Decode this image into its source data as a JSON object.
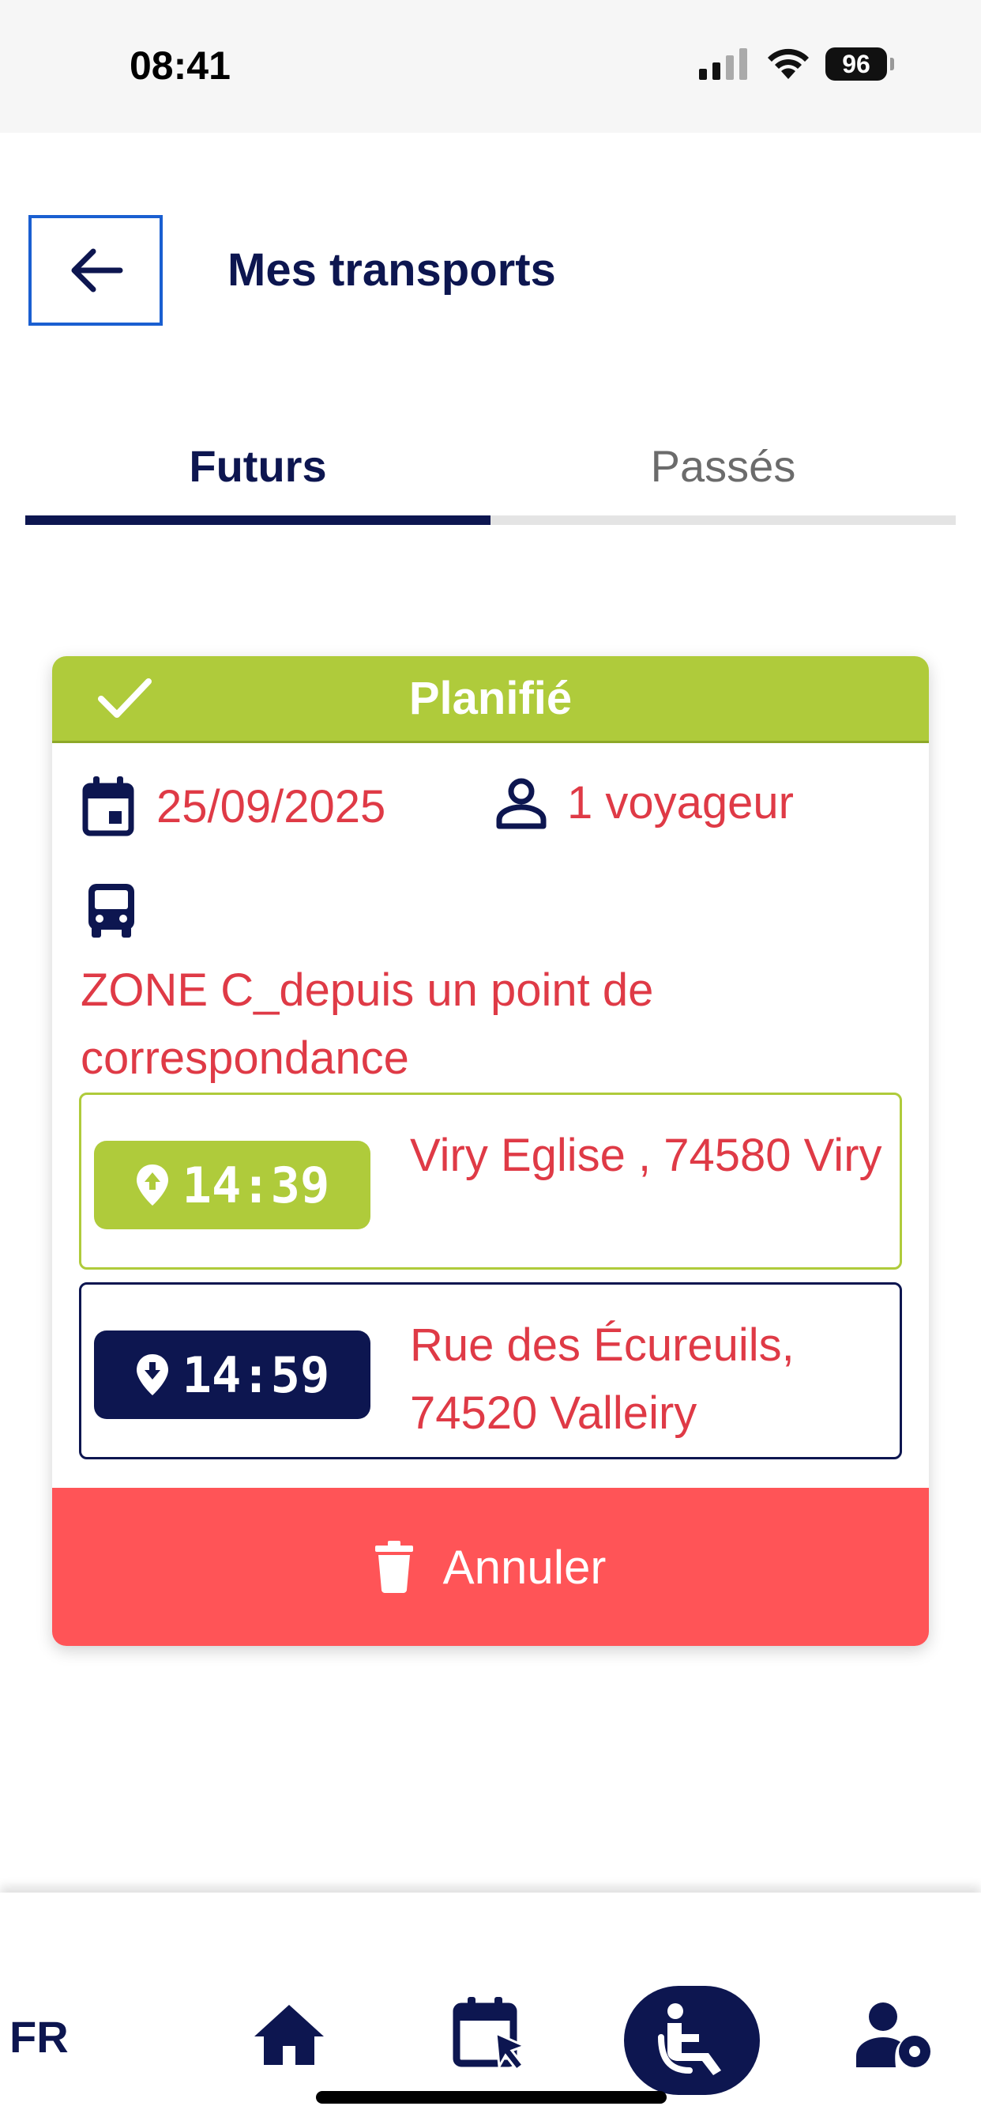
{
  "status_bar": {
    "time": "08:41",
    "battery": "96"
  },
  "header": {
    "title": "Mes transports",
    "back_label": "Retour"
  },
  "tabs": [
    {
      "label": "Futurs",
      "active": true
    },
    {
      "label": "Passés",
      "active": false
    }
  ],
  "trip": {
    "status": "Planifié",
    "date": "25/09/2025",
    "passengers": "1 voyageur",
    "zone": "ZONE C_depuis un point de correspondance",
    "departure": {
      "time": "14:39",
      "address": "Viry Eglise , 74580 Viry"
    },
    "arrival": {
      "time": "14:59",
      "address": "Rue des Écureuils, 74520 Valleiry"
    },
    "cancel_label": "Annuler"
  },
  "bottom_nav": {
    "language": "FR",
    "items": [
      {
        "icon": "home-icon"
      },
      {
        "icon": "calendar-select-icon"
      },
      {
        "icon": "accessibility-icon",
        "active": true
      },
      {
        "icon": "user-settings-icon"
      }
    ]
  },
  "colors": {
    "primary": "#0d1650",
    "planned": "#afcb3b",
    "text_red": "#df3a46",
    "cancel": "#ff5457",
    "link_border": "#1a5fd1"
  }
}
